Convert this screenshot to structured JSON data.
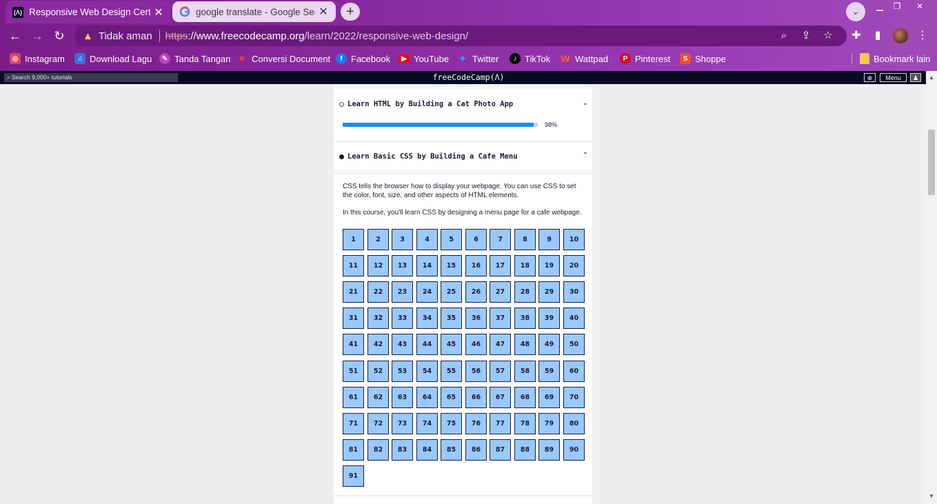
{
  "browser": {
    "tabs": [
      {
        "title": "Responsive Web Design Certifica",
        "favicon": "(Ʌ)"
      },
      {
        "title": "google translate - Google Search",
        "favicon": "G"
      }
    ],
    "new_tab": "+",
    "address": {
      "security_label": "Tidak aman",
      "scheme": "https",
      "host": "://www.freecodecamp.org",
      "path": "/learn/2022/responsive-web-design/"
    },
    "bookmarks": [
      {
        "label": "Instagram",
        "color": "#e4405f",
        "icon": "instagram-icon"
      },
      {
        "label": "Download Lagu",
        "color": "#3b6fd8",
        "icon": "music-icon"
      },
      {
        "label": "Tanda Tangan",
        "color": "#c040c0",
        "icon": "signature-icon"
      },
      {
        "label": "Conversi Document",
        "color": "#e23b3b",
        "icon": "heart-icon"
      },
      {
        "label": "Facebook",
        "color": "#1877f2",
        "icon": "facebook-icon"
      },
      {
        "label": "YouTube",
        "color": "#ff0000",
        "icon": "youtube-icon"
      },
      {
        "label": "Twitter",
        "color": "#1da1f2",
        "icon": "twitter-icon"
      },
      {
        "label": "TikTok",
        "color": "#000000",
        "icon": "tiktok-icon"
      },
      {
        "label": "Wattpad",
        "color": "#ff6122",
        "icon": "wattpad-icon"
      },
      {
        "label": "Pinterest",
        "color": "#e60023",
        "icon": "pinterest-icon"
      },
      {
        "label": "Shoppe",
        "color": "#ee4d2d",
        "icon": "shopee-icon"
      }
    ],
    "other_bookmarks": "Bookmark lain"
  },
  "fcc_nav": {
    "search_placeholder": "Search 9,000+ tutorials",
    "logo": "freeCodeCamp(Ʌ)",
    "menu_label": "Menu"
  },
  "blocks": [
    {
      "title": "Learn HTML by Building a Cat Photo App",
      "progress_percent": 98,
      "progress_label": "98%",
      "expanded": false
    },
    {
      "title": "Learn Basic CSS by Building a Cafe Menu",
      "expanded": true,
      "description": [
        "CSS tells the browser how to display your webpage. You can use CSS to set the color, font, size, and other aspects of HTML elements.",
        "In this course, you'll learn CSS by designing a menu page for a cafe webpage."
      ],
      "step_count": 91
    }
  ],
  "colors": {
    "accent": "#198eee",
    "step_bg": "#99c9ff",
    "nav_bg": "#0a0a23"
  }
}
